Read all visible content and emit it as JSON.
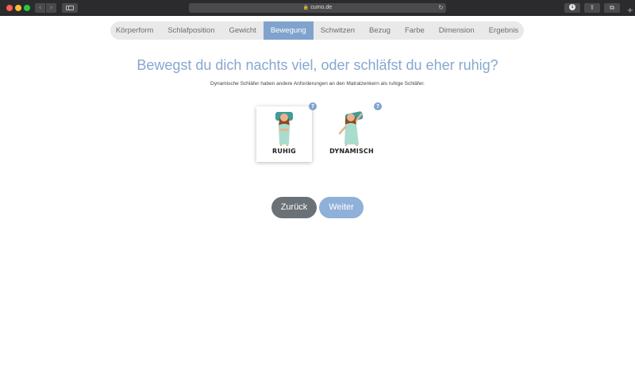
{
  "browser": {
    "url": "cumo.de",
    "nav_back_glyph": "‹",
    "nav_forward_glyph": "›",
    "reload_glyph": "↻",
    "download_glyph": "↓",
    "share_glyph": "⇪",
    "tabs_glyph": "⧉",
    "new_tab_glyph": "+"
  },
  "steps": [
    {
      "label": "Körperform"
    },
    {
      "label": "Schlafposition"
    },
    {
      "label": "Gewicht"
    },
    {
      "label": "Bewegung",
      "active": true
    },
    {
      "label": "Schwitzen"
    },
    {
      "label": "Bezug"
    },
    {
      "label": "Farbe"
    },
    {
      "label": "Dimension"
    },
    {
      "label": "Ergebnis"
    }
  ],
  "question": {
    "title": "Bewegst du dich nachts viel, oder schläfst du eher ruhig?",
    "subtitle": "Dynamische Schläfer haben andere Anforderungen an den Matratzenkern als ruhige Schläfer."
  },
  "options": [
    {
      "label": "RUHIG",
      "selected": true,
      "help": "?"
    },
    {
      "label": "DYNAMISCH",
      "selected": false,
      "help": "?"
    }
  ],
  "buttons": {
    "back_label": "Zurück",
    "next_label": "Weiter"
  },
  "colors": {
    "accent": "#7fa3cc",
    "title": "#86a7cf",
    "back_button": "#6a7177",
    "next_button": "#8fb0d8",
    "steps_bg": "#e9e9ea"
  }
}
